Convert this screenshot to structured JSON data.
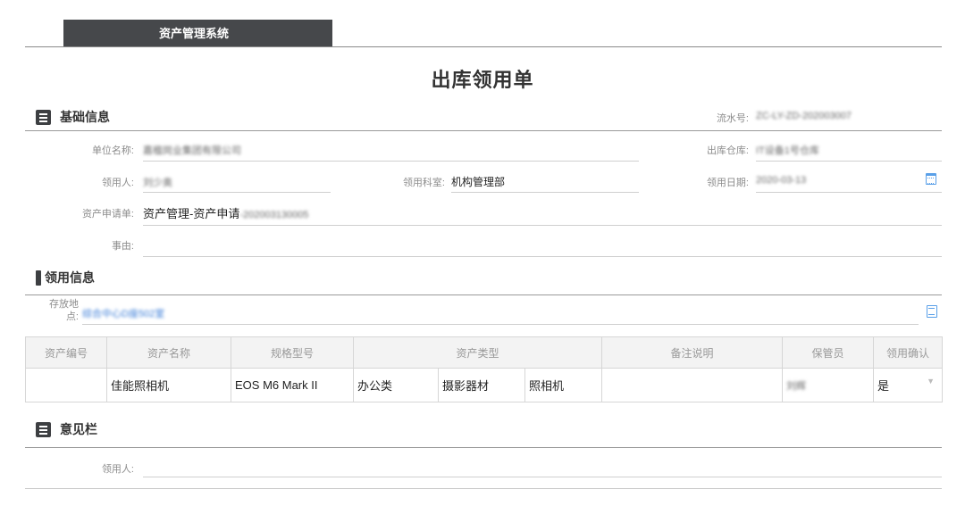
{
  "app": {
    "tab_label": "资产管理系统"
  },
  "form": {
    "title": "出库领用单"
  },
  "basic": {
    "title": "基础信息",
    "serial_label": "流水号:",
    "serial_value": "ZC-LY-ZD-202003007",
    "unit_label": "单位名称:",
    "unit_value": "嘉楹岗业集团有限公司",
    "warehouse_label": "出库仓库:",
    "warehouse_value": "IT设备1号仓库",
    "recipient_label": "领用人:",
    "recipient_value": "刘少奥",
    "dept_label": "领用科室:",
    "dept_value": "机构管理部",
    "date_label": "领用日期:",
    "date_value": "2020-03-13",
    "request_label": "资产申请单:",
    "request_value": "资产管理-资产申请",
    "request_value_suffix": "-202003130005",
    "reason_label": "事由:",
    "reason_value": ""
  },
  "usage": {
    "title": "领用信息",
    "location_label_line1": "存放地",
    "location_label_line2": "点:",
    "location_value": "综合中心D座502室"
  },
  "table": {
    "headers": [
      "资产编号",
      "资产名称",
      "规格型号",
      "资产类型",
      "备注说明",
      "保管员",
      "领用确认"
    ],
    "row": {
      "asset_no": "",
      "name": "佳能照相机",
      "model": "EOS M6 Mark II",
      "type1": "办公类",
      "type2": "摄影器材",
      "type3": "照相机",
      "note": "",
      "keeper": "刘辉",
      "confirm": "是"
    }
  },
  "opinion": {
    "title": "意见栏",
    "recipient_label": "领用人:",
    "recipient_value": ""
  }
}
